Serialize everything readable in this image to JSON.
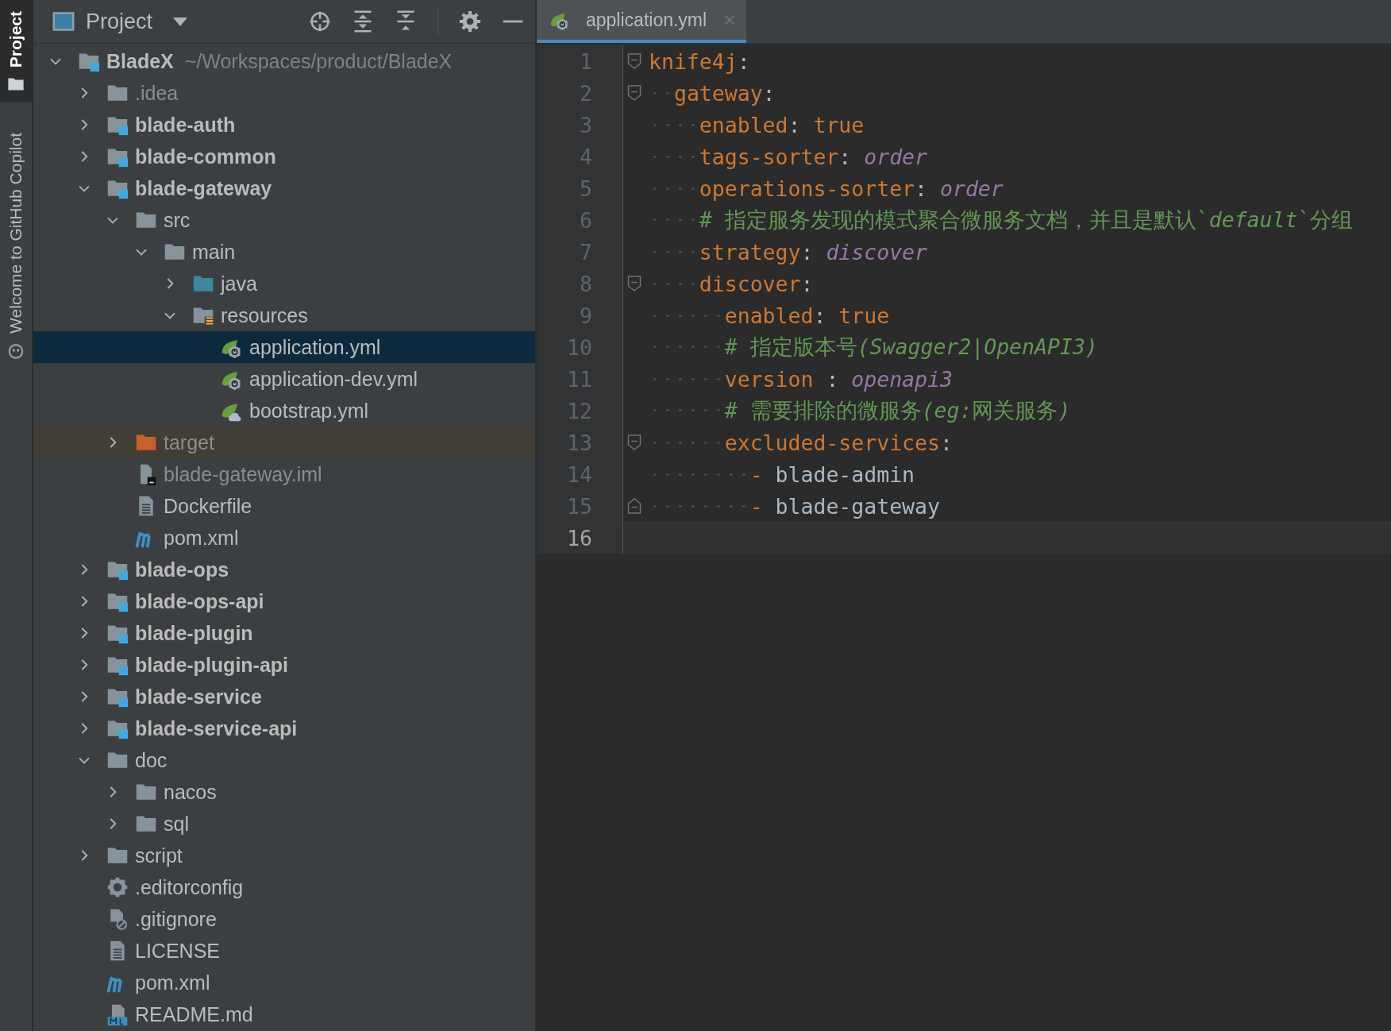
{
  "tool_stripe": [
    {
      "label": "Project",
      "kind": "project",
      "selected": true
    },
    {
      "label": "Welcome to GitHub Copilot",
      "kind": "copilot",
      "selected": false
    }
  ],
  "project_panel": {
    "title": "Project",
    "tree": [
      {
        "name": "BladeX",
        "path": "~/Workspaces/product/BladeX",
        "kind": "module",
        "expanded": true,
        "selected": false,
        "ignored": false,
        "children": [
          {
            "name": ".idea",
            "kind": "folder",
            "expanded": false,
            "selected": false,
            "ignored": true
          },
          {
            "name": "blade-auth",
            "kind": "module",
            "expanded": false,
            "selected": false,
            "ignored": false
          },
          {
            "name": "blade-common",
            "kind": "module",
            "expanded": false,
            "selected": false,
            "ignored": false
          },
          {
            "name": "blade-gateway",
            "kind": "module",
            "expanded": true,
            "selected": false,
            "ignored": false,
            "children": [
              {
                "name": "src",
                "kind": "folder",
                "expanded": true,
                "selected": false,
                "ignored": false,
                "children": [
                  {
                    "name": "main",
                    "kind": "folder",
                    "expanded": true,
                    "selected": false,
                    "ignored": false,
                    "children": [
                      {
                        "name": "java",
                        "kind": "source-root",
                        "expanded": false,
                        "selected": false,
                        "ignored": false
                      },
                      {
                        "name": "resources",
                        "kind": "resource-root",
                        "expanded": true,
                        "selected": false,
                        "ignored": false,
                        "children": [
                          {
                            "name": "application.yml",
                            "kind": "spring-config",
                            "selected": true,
                            "ignored": false
                          },
                          {
                            "name": "application-dev.yml",
                            "kind": "spring-config",
                            "selected": false,
                            "ignored": false
                          },
                          {
                            "name": "bootstrap.yml",
                            "kind": "spring-bootstrap",
                            "selected": false,
                            "ignored": false
                          }
                        ]
                      }
                    ]
                  }
                ]
              },
              {
                "name": "target",
                "kind": "excluded",
                "expanded": false,
                "selected": false,
                "ignored": true
              },
              {
                "name": "blade-gateway.iml",
                "kind": "iml",
                "selected": false,
                "ignored": true
              },
              {
                "name": "Dockerfile",
                "kind": "text",
                "selected": false,
                "ignored": false
              },
              {
                "name": "pom.xml",
                "kind": "maven",
                "selected": false,
                "ignored": false
              }
            ]
          },
          {
            "name": "blade-ops",
            "kind": "module",
            "expanded": false,
            "selected": false,
            "ignored": false
          },
          {
            "name": "blade-ops-api",
            "kind": "module",
            "expanded": false,
            "selected": false,
            "ignored": false
          },
          {
            "name": "blade-plugin",
            "kind": "module",
            "expanded": false,
            "selected": false,
            "ignored": false
          },
          {
            "name": "blade-plugin-api",
            "kind": "module",
            "expanded": false,
            "selected": false,
            "ignored": false
          },
          {
            "name": "blade-service",
            "kind": "module",
            "expanded": false,
            "selected": false,
            "ignored": false
          },
          {
            "name": "blade-service-api",
            "kind": "module",
            "expanded": false,
            "selected": false,
            "ignored": false
          },
          {
            "name": "doc",
            "kind": "folder",
            "expanded": true,
            "selected": false,
            "ignored": false,
            "children": [
              {
                "name": "nacos",
                "kind": "folder",
                "expanded": false,
                "selected": false,
                "ignored": false
              },
              {
                "name": "sql",
                "kind": "folder",
                "expanded": false,
                "selected": false,
                "ignored": false
              }
            ]
          },
          {
            "name": "script",
            "kind": "folder",
            "expanded": false,
            "selected": false,
            "ignored": false
          },
          {
            "name": ".editorconfig",
            "kind": "editorconfig",
            "selected": false,
            "ignored": false
          },
          {
            "name": ".gitignore",
            "kind": "gitignore",
            "selected": false,
            "ignored": false
          },
          {
            "name": "LICENSE",
            "kind": "text",
            "selected": false,
            "ignored": false
          },
          {
            "name": "pom.xml",
            "kind": "maven",
            "selected": false,
            "ignored": false
          },
          {
            "name": "README.md",
            "kind": "markdown",
            "selected": false,
            "ignored": false
          }
        ]
      }
    ]
  },
  "editor": {
    "tabs": [
      {
        "label": "application.yml",
        "kind": "spring-config",
        "selected": true
      }
    ],
    "lines": [
      {
        "number": "1",
        "kind": "fold-start",
        "current": false,
        "tokens": [
          {
            "kind": "key",
            "text": "knife4j"
          },
          {
            "kind": "punct",
            "text": ":"
          }
        ]
      },
      {
        "number": "2",
        "kind": "fold-start",
        "current": false,
        "tokens": [
          {
            "kind": "key",
            "text": "  gateway"
          },
          {
            "kind": "punct",
            "text": ":"
          }
        ]
      },
      {
        "number": "3",
        "kind": "plain",
        "current": false,
        "tokens": [
          {
            "kind": "key",
            "text": "    enabled"
          },
          {
            "kind": "punct",
            "text": ": "
          },
          {
            "kind": "key",
            "text": "true"
          }
        ]
      },
      {
        "number": "4",
        "kind": "plain",
        "current": false,
        "tokens": [
          {
            "kind": "key",
            "text": "    tags-sorter"
          },
          {
            "kind": "punct",
            "text": ": "
          },
          {
            "kind": "value",
            "text": "order"
          }
        ]
      },
      {
        "number": "5",
        "kind": "plain",
        "current": false,
        "tokens": [
          {
            "kind": "key",
            "text": "    operations-sorter"
          },
          {
            "kind": "punct",
            "text": ": "
          },
          {
            "kind": "value",
            "text": "order"
          }
        ]
      },
      {
        "number": "6",
        "kind": "plain",
        "current": false,
        "tokens": [
          {
            "kind": "comment",
            "text": "    # 指定服务发现的模式聚合微服务文档，并且是默认`"
          },
          {
            "kind": "comment-italic",
            "text": "default"
          },
          {
            "kind": "comment",
            "text": "`分组"
          }
        ]
      },
      {
        "number": "7",
        "kind": "plain",
        "current": false,
        "tokens": [
          {
            "kind": "key",
            "text": "    strategy"
          },
          {
            "kind": "punct",
            "text": ": "
          },
          {
            "kind": "value",
            "text": "discover"
          }
        ]
      },
      {
        "number": "8",
        "kind": "fold-start",
        "current": false,
        "tokens": [
          {
            "kind": "key",
            "text": "    discover"
          },
          {
            "kind": "punct",
            "text": ":"
          }
        ]
      },
      {
        "number": "9",
        "kind": "plain",
        "current": false,
        "tokens": [
          {
            "kind": "key",
            "text": "      enabled"
          },
          {
            "kind": "punct",
            "text": ": "
          },
          {
            "kind": "key",
            "text": "true"
          }
        ]
      },
      {
        "number": "10",
        "kind": "plain",
        "current": false,
        "tokens": [
          {
            "kind": "comment",
            "text": "      # 指定版本号"
          },
          {
            "kind": "comment-italic",
            "text": "(Swagger2|OpenAPI3)"
          }
        ]
      },
      {
        "number": "11",
        "kind": "plain",
        "current": false,
        "tokens": [
          {
            "kind": "key",
            "text": "      version "
          },
          {
            "kind": "punct",
            "text": ": "
          },
          {
            "kind": "value",
            "text": "openapi3"
          }
        ]
      },
      {
        "number": "12",
        "kind": "plain",
        "current": false,
        "tokens": [
          {
            "kind": "comment",
            "text": "      # 需要排除的微服务"
          },
          {
            "kind": "comment-italic",
            "text": "(eg:"
          },
          {
            "kind": "comment",
            "text": "网关服务"
          },
          {
            "kind": "comment-italic",
            "text": ")"
          }
        ]
      },
      {
        "number": "13",
        "kind": "fold-start",
        "current": false,
        "tokens": [
          {
            "kind": "key",
            "text": "      excluded-services"
          },
          {
            "kind": "punct",
            "text": ":"
          }
        ]
      },
      {
        "number": "14",
        "kind": "plain",
        "current": false,
        "tokens": [
          {
            "kind": "key",
            "text": "        - "
          },
          {
            "kind": "plain",
            "text": "blade-admin"
          }
        ]
      },
      {
        "number": "15",
        "kind": "fold-end",
        "current": false,
        "tokens": [
          {
            "kind": "key",
            "text": "        - "
          },
          {
            "kind": "plain",
            "text": "blade-gateway"
          }
        ]
      },
      {
        "number": "16",
        "kind": "plain",
        "current": true
      }
    ]
  }
}
